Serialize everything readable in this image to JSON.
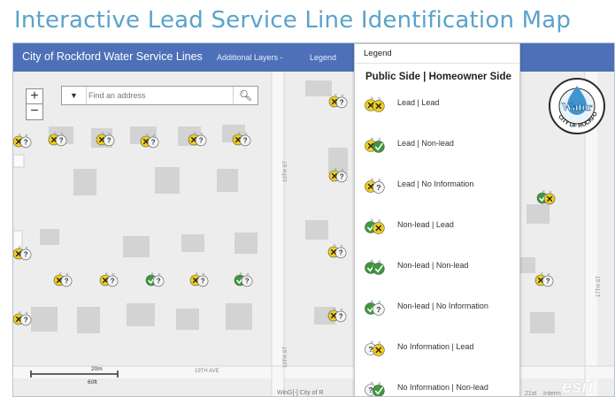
{
  "page": {
    "title": "Interactive Lead Service Line Identification Map"
  },
  "header": {
    "app_title": "City of Rockford Water Service Lines",
    "nav": [
      {
        "label": "Additional Layers -"
      },
      {
        "label": "Legend"
      }
    ]
  },
  "search": {
    "placeholder": "Find an address",
    "dropdown_icon": "caret-down-icon",
    "search_icon": "magnifier-icon"
  },
  "zoom": {
    "in_label": "+",
    "out_label": "−"
  },
  "legend": {
    "title": "Legend",
    "subtitle": "Public Side | Homeowner Side",
    "items": [
      {
        "label": "Lead | Lead",
        "public": "lead",
        "homeowner": "lead"
      },
      {
        "label": "Lead | Non-lead",
        "public": "lead",
        "homeowner": "nonlead"
      },
      {
        "label": "Lead | No Information",
        "public": "lead",
        "homeowner": "noinfo"
      },
      {
        "label": "Non-lead | Lead",
        "public": "nonlead",
        "homeowner": "lead"
      },
      {
        "label": "Non-lead | Non-lead",
        "public": "nonlead",
        "homeowner": "nonlead"
      },
      {
        "label": "Non-lead | No Information",
        "public": "nonlead",
        "homeowner": "noinfo"
      },
      {
        "label": "No Information | Lead",
        "public": "noinfo",
        "homeowner": "lead"
      },
      {
        "label": "No Information | Non-lead",
        "public": "noinfo",
        "homeowner": "nonlead"
      }
    ]
  },
  "streets": {
    "s1": "10TH ST",
    "s2": "10TH ST",
    "s3": "19TH AVE",
    "s4": "17TH ST"
  },
  "scale": {
    "top_label": "20m",
    "bottom_label": "60ft"
  },
  "attribution": {
    "left": "WinG[-] City of R",
    "right_a": "21st",
    "right_b": "Interm"
  },
  "brand": {
    "esri": "esri",
    "logo_word": "Water",
    "logo_ring": "CITY OF ROCKFORD"
  },
  "colors": {
    "lead": "#f2cf1c",
    "nonlead": "#3c9a3a",
    "noinfo": "#f4f4f4",
    "header": "#4d70b8",
    "title": "#5aa3c9"
  }
}
